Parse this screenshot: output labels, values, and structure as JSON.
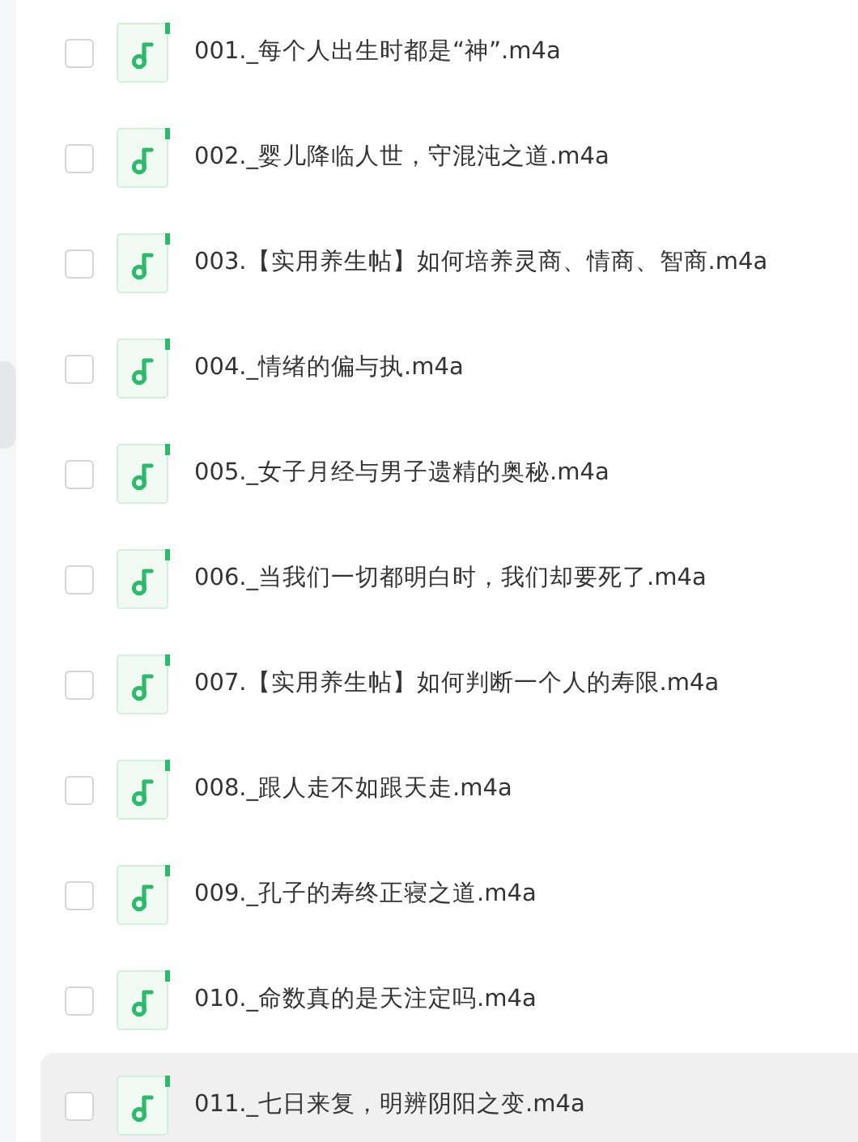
{
  "files": [
    {
      "name": "001._每个人出生时都是“神”.m4a",
      "checked": false,
      "highlighted": false
    },
    {
      "name": "002._婴儿降临人世，守混沌之道.m4a",
      "checked": false,
      "highlighted": false
    },
    {
      "name": "003.【实用养生帖】如何培养灵商、情商、智商.m4a",
      "checked": false,
      "highlighted": false
    },
    {
      "name": "004._情绪的偏与执.m4a",
      "checked": false,
      "highlighted": false
    },
    {
      "name": "005._女子月经与男子遗精的奥秘.m4a",
      "checked": false,
      "highlighted": false
    },
    {
      "name": "006._当我们一切都明白时，我们却要死了.m4a",
      "checked": false,
      "highlighted": false
    },
    {
      "name": "007.【实用养生帖】如何判断一个人的寿限.m4a",
      "checked": false,
      "highlighted": false
    },
    {
      "name": "008._跟人走不如跟天走.m4a",
      "checked": false,
      "highlighted": false
    },
    {
      "name": "009._孔子的寿终正寝之道.m4a",
      "checked": false,
      "highlighted": false
    },
    {
      "name": "010._命数真的是天注定吗.m4a",
      "checked": false,
      "highlighted": false
    },
    {
      "name": "011._七日来复，明辨阴阳之变.m4a",
      "checked": false,
      "highlighted": true
    }
  ]
}
